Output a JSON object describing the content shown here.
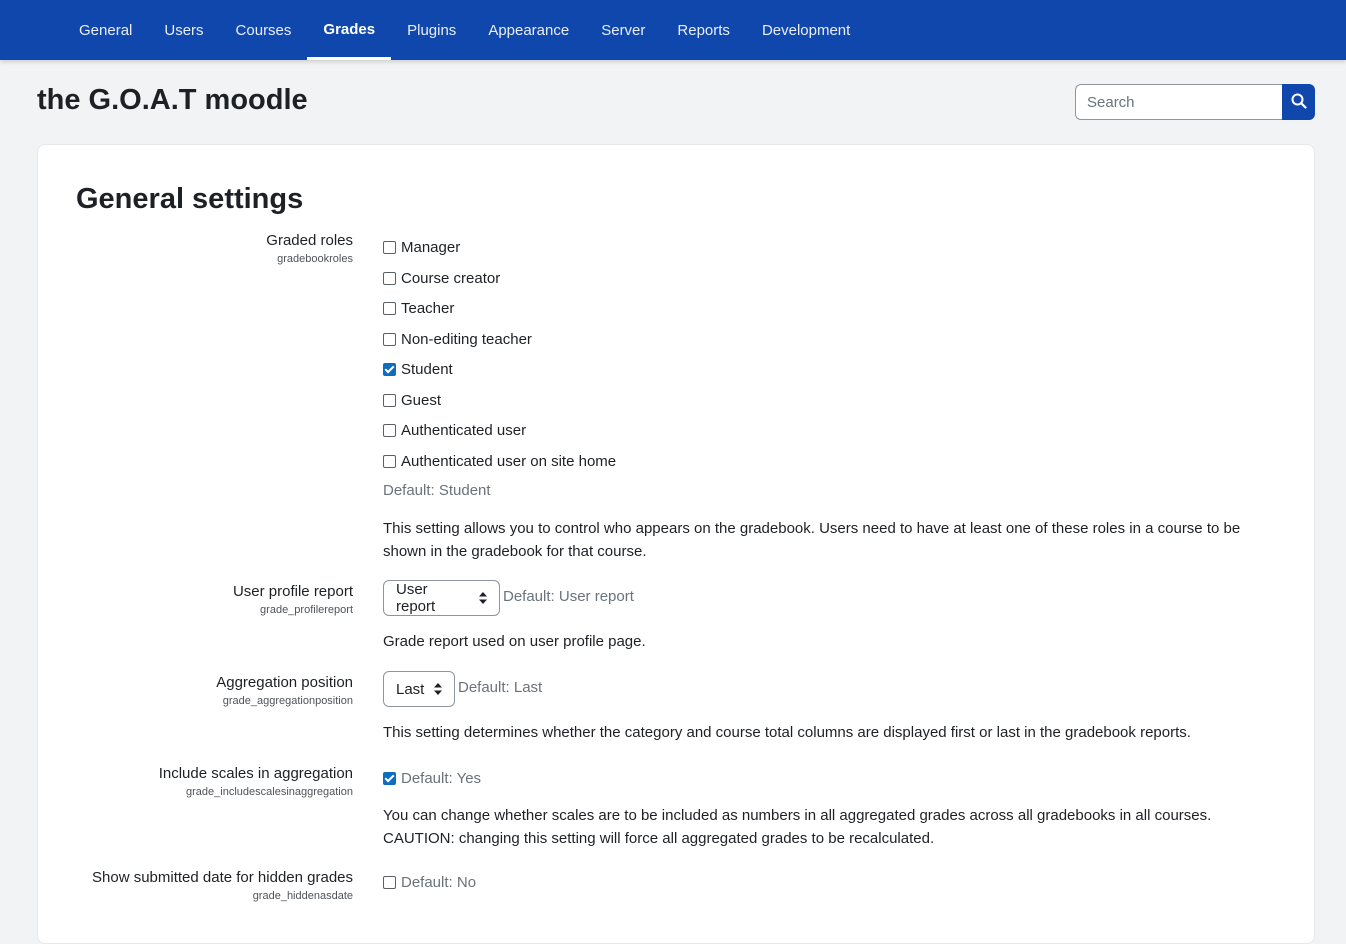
{
  "nav": {
    "items": [
      {
        "label": "General"
      },
      {
        "label": "Users"
      },
      {
        "label": "Courses"
      },
      {
        "label": "Grades",
        "active": true
      },
      {
        "label": "Plugins"
      },
      {
        "label": "Appearance"
      },
      {
        "label": "Server"
      },
      {
        "label": "Reports"
      },
      {
        "label": "Development"
      }
    ]
  },
  "site": {
    "title": "the G.O.A.T moodle"
  },
  "search": {
    "placeholder": "Search",
    "icon": "search-icon"
  },
  "page": {
    "heading": "General settings"
  },
  "settings": {
    "graded_roles": {
      "label": "Graded roles",
      "key": "gradebookroles",
      "options": [
        {
          "label": "Manager",
          "checked": false
        },
        {
          "label": "Course creator",
          "checked": false
        },
        {
          "label": "Teacher",
          "checked": false
        },
        {
          "label": "Non-editing teacher",
          "checked": false
        },
        {
          "label": "Student",
          "checked": true
        },
        {
          "label": "Guest",
          "checked": false
        },
        {
          "label": "Authenticated user",
          "checked": false
        },
        {
          "label": "Authenticated user on site home",
          "checked": false
        }
      ],
      "default": "Default: Student",
      "description": "This setting allows you to control who appears on the gradebook. Users need to have at least one of these roles in a course to be shown in the gradebook for that course."
    },
    "profile_report": {
      "label": "User profile report",
      "key": "grade_profilereport",
      "selected": "User report",
      "default": "Default: User report",
      "description": "Grade report used on user profile page."
    },
    "aggregation_position": {
      "label": "Aggregation position",
      "key": "grade_aggregationposition",
      "selected": "Last",
      "default": "Default: Last",
      "description": "This setting determines whether the category and course total columns are displayed first or last in the gradebook reports."
    },
    "include_scales": {
      "label": "Include scales in aggregation",
      "key": "grade_includescalesinaggregation",
      "checked": true,
      "default": "Default: Yes",
      "description_line1": "You can change whether scales are to be included as numbers in all aggregated grades across all gradebooks in all courses.",
      "description_line2": "CAUTION: changing this setting will force all aggregated grades to be recalculated."
    },
    "hiddenasdate": {
      "label": "Show submitted date for hidden grades",
      "key": "grade_hiddenasdate",
      "checked": false,
      "default": "Default: No"
    }
  },
  "colors": {
    "nav_bg": "#0f47ad",
    "accent": "#0f6cbf",
    "muted": "#6a737b"
  }
}
